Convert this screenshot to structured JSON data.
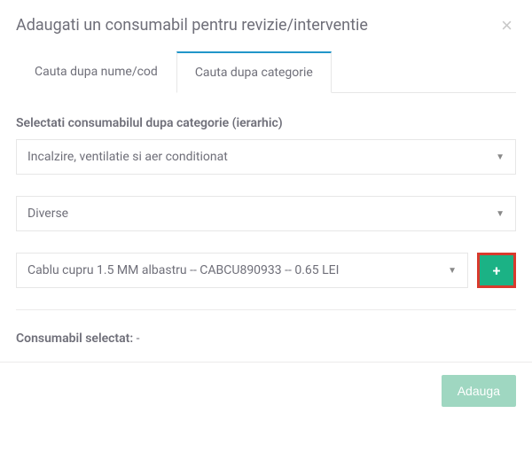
{
  "modal": {
    "title": "Adaugati un consumabil pentru revizie/interventie",
    "close_glyph": "×"
  },
  "tabs": [
    {
      "label": "Cauta dupa nume/cod",
      "active": false
    },
    {
      "label": "Cauta dupa categorie",
      "active": true
    }
  ],
  "form": {
    "section_label": "Selectati consumabilul dupa categorie (ierarhic)",
    "selects": {
      "category1": "Incalzire, ventilatie si aer conditionat",
      "category2": "Diverse",
      "product": "Cablu cupru 1.5 MM albastru -- CABCU890933 -- 0.65 LEI"
    }
  },
  "selected": {
    "label": "Consumabil selectat: ",
    "value": "-"
  },
  "footer": {
    "submit_label": "Adauga"
  },
  "icons": {
    "caret": "▼",
    "plus": "+"
  }
}
